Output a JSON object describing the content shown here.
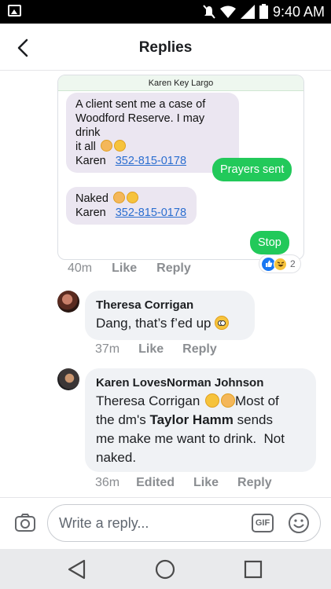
{
  "status_bar": {
    "time": "9:40 AM"
  },
  "header": {
    "title": "Replies"
  },
  "shot": {
    "contact_name": "Karen Key Largo",
    "msg1_line1": "A client sent me a case of",
    "msg1_line2": "Woodford Reserve. I may drink",
    "msg1_line3": "it all",
    "sender": "Karen",
    "phone": "352-815-0178",
    "msg_prayers": "Prayers sent",
    "msg_naked": "Naked",
    "msg_stop": "Stop"
  },
  "post_meta": {
    "time": "40m",
    "like": "Like",
    "reply": "Reply",
    "reaction_count": "2"
  },
  "comments": [
    {
      "author": "Theresa Corrigan",
      "text": "Dang, that’s f’ed up",
      "time": "37m",
      "like": "Like",
      "reply": "Reply"
    },
    {
      "author": "Karen LovesNorman Johnson",
      "mention1": "Theresa Corrigan",
      "text_a": "Most of",
      "text_b": "the dm's",
      "mention2": "Taylor Hamm",
      "text_c": "sends",
      "line3": "me make me want to drink.  Not",
      "line4": "naked.",
      "time": "36m",
      "edited": "Edited",
      "like": "Like",
      "reply": "Reply"
    }
  ],
  "composer": {
    "placeholder": "Write a reply...",
    "gif": "GIF"
  },
  "colors": {
    "green": "#22c95a",
    "link": "#2b6ed0",
    "like_blue": "#1877f2",
    "bubble_bg": "#f0f2f5"
  }
}
